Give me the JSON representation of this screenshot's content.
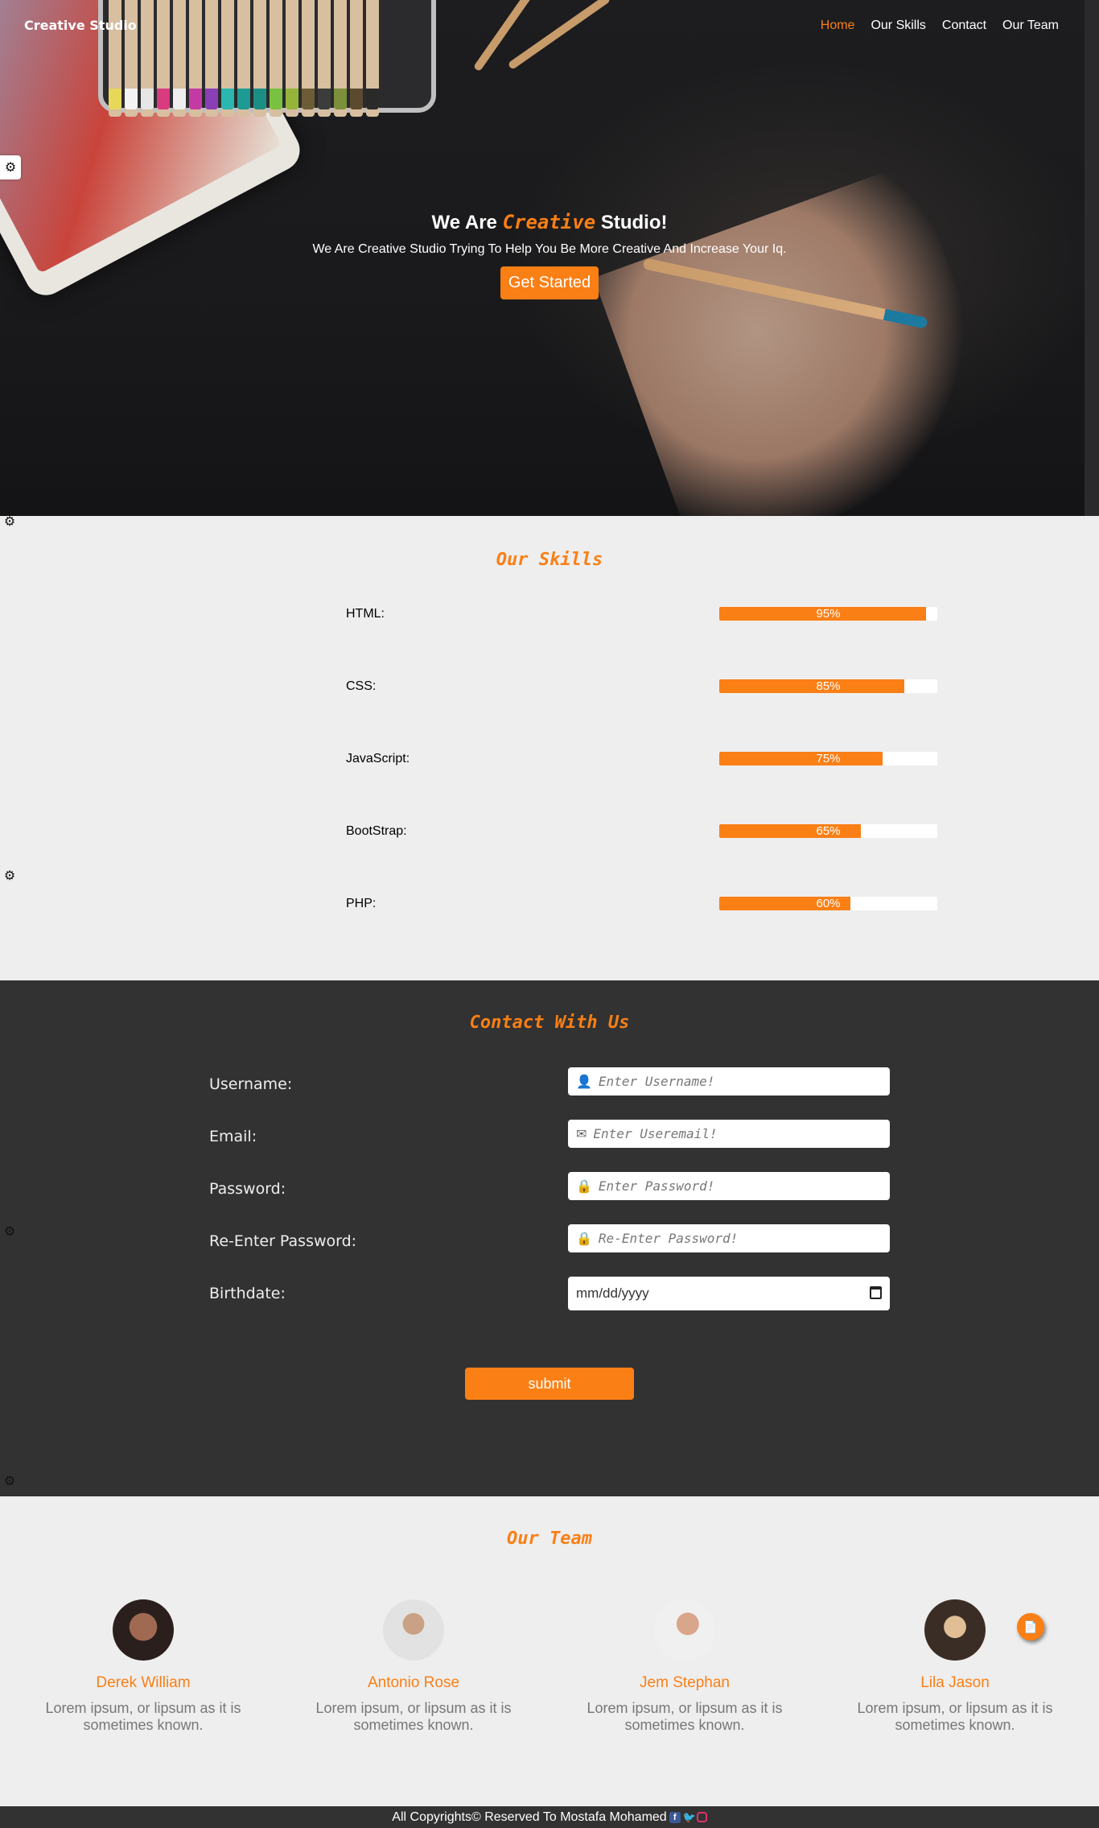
{
  "brand": "Creative Studio",
  "nav": {
    "items": [
      {
        "label": "Home",
        "active": true
      },
      {
        "label": "Our Skills",
        "active": false
      },
      {
        "label": "Contact",
        "active": false
      },
      {
        "label": "Our Team",
        "active": false
      }
    ]
  },
  "hero": {
    "title_before": "We Are",
    "title_highlight": "Creative",
    "title_after": "Studio!",
    "subtitle": "We Are Creative Studio Trying To Help You Be More Creative And Increase Your Iq.",
    "button_label": "Get Started"
  },
  "skills": {
    "title": "Our Skills",
    "items": [
      {
        "name": "HTML:",
        "percent_label": "95%",
        "level": 0.95
      },
      {
        "name": "CSS:",
        "percent_label": "85%",
        "level": 0.85
      },
      {
        "name": "JavaScript:",
        "percent_label": "75%",
        "level": 0.75
      },
      {
        "name": "BootStrap:",
        "percent_label": "65%",
        "level": 0.65
      },
      {
        "name": "PHP:",
        "percent_label": "60%",
        "level": 0.6
      }
    ]
  },
  "contact": {
    "title": "Contact With Us",
    "fields": [
      {
        "label": "Username:",
        "icon": "user-icon",
        "placeholder": "Enter Username!"
      },
      {
        "label": "Email:",
        "icon": "envelope-icon",
        "placeholder": "Enter Useremail!"
      },
      {
        "label": "Password:",
        "icon": "lock-icon",
        "placeholder": "Enter Password!"
      },
      {
        "label": "Re-Enter Password:",
        "icon": "lock-icon",
        "placeholder": "Re-Enter Password!"
      }
    ],
    "birthdate_label": "Birthdate:",
    "birthdate_placeholder": "mm/dd/yyyy",
    "submit_label": "submit"
  },
  "team": {
    "title": "Our Team",
    "members": [
      {
        "name": "Derek William",
        "desc": "Lorem ipsum, or lipsum as it is sometimes known."
      },
      {
        "name": "Antonio Rose",
        "desc": "Lorem ipsum, or lipsum as it is sometimes known."
      },
      {
        "name": "Jem Stephan",
        "desc": "Lorem ipsum, or lipsum as it is sometimes known."
      },
      {
        "name": "Lila Jason",
        "desc": "Lorem ipsum, or lipsum as it is sometimes known."
      }
    ]
  },
  "footer": {
    "text": "All Copyrights© Reserved To Mostafa Mohamed"
  },
  "colors": {
    "accent": "#fa7f15",
    "dark_section": "#323232",
    "light_section": "#eeeeee"
  }
}
